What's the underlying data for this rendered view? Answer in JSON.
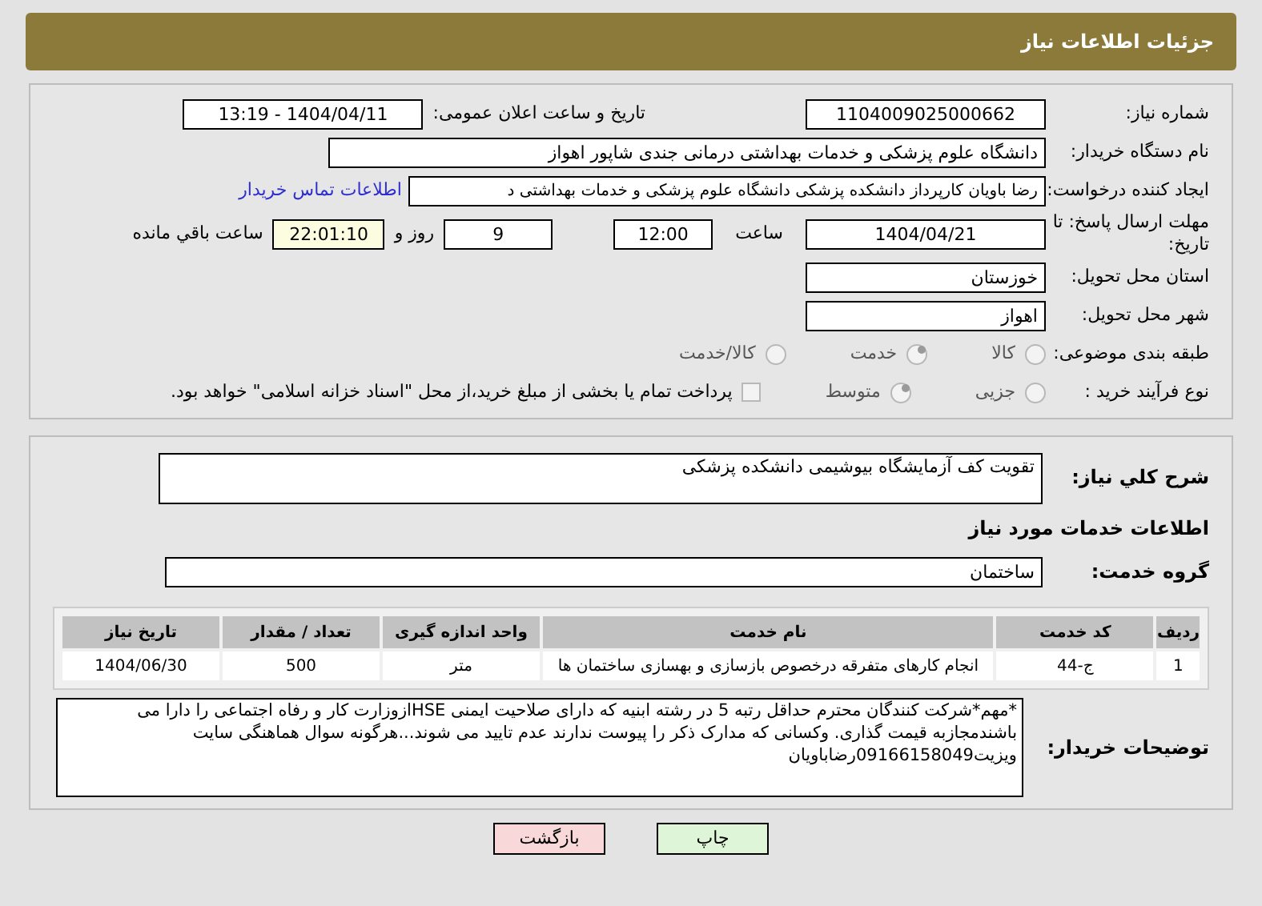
{
  "header": {
    "title": "جزئیات اطلاعات نیاز"
  },
  "details": {
    "need_number": {
      "label": "شماره نیاز:",
      "value": "1104009025000662"
    },
    "announce": {
      "label": "تاریخ و ساعت اعلان عمومی:",
      "value": "1404/04/11 - 13:19"
    },
    "buyer": {
      "label": "نام دستگاه خریدار:",
      "value": "دانشگاه علوم پزشکی و خدمات بهداشتی درمانی جندی شاپور اهواز"
    },
    "creator": {
      "label": "ایجاد کننده درخواست:",
      "value": "رضا باویان کارپرداز دانشکده پزشکی دانشگاه علوم پزشکی و خدمات بهداشتی د",
      "link": "اطلاعات تماس خریدار"
    },
    "deadline": {
      "label": "مهلت ارسال پاسخ: تا تاریخ:",
      "date": "1404/04/21",
      "time_label": "ساعت",
      "time": "12:00",
      "days": "9",
      "days_label": "روز و",
      "remaining": "22:01:10",
      "remaining_label": "ساعت باقي مانده"
    },
    "province": {
      "label": "استان محل تحویل:",
      "value": "خوزستان"
    },
    "city": {
      "label": "شهر محل تحویل:",
      "value": "اهواز"
    },
    "category": {
      "label": "طبقه بندی موضوعی:",
      "options": [
        {
          "label": "کالا",
          "selected": false
        },
        {
          "label": "خدمت",
          "selected": true
        },
        {
          "label": "کالا/خدمت",
          "selected": false
        }
      ]
    },
    "process": {
      "label": "نوع فرآیند خرید :",
      "options": [
        {
          "label": "جزیی",
          "selected": false
        },
        {
          "label": "متوسط",
          "selected": true
        }
      ],
      "treasury": {
        "label": "پرداخت تمام یا بخشی از مبلغ خرید،از محل \"اسناد خزانه اسلامی\" خواهد بود.",
        "checked": false
      }
    }
  },
  "services": {
    "summary": {
      "label": "شرح کلي نیاز:",
      "value": "تقویت کف آزمایشگاه بیوشیمی دانشکده پزشکی"
    },
    "heading": "اطلاعات خدمات مورد نیاز",
    "group": {
      "label": "گروه خدمت:",
      "value": "ساختمان"
    },
    "table": {
      "columns": [
        "ردیف",
        "کد خدمت",
        "نام خدمت",
        "واحد اندازه گیری",
        "تعداد / مقدار",
        "تاریخ نیاز"
      ],
      "rows": [
        [
          "1",
          "ج-44",
          "انجام کارهای متفرقه درخصوص بازسازی و بهسازی ساختمان ها",
          "متر",
          "500",
          "1404/06/30"
        ]
      ]
    },
    "notes": {
      "label": "توضیحات خریدار:",
      "value": "*مهم*شرکت کنندگان محترم حداقل  رتبه 5 در رشته ابنیه که دارای صلاحیت ایمنی HSEازوزارت کار و رفاه اجتماعی را دارا می باشندمجازبه قیمت گذاری. وکسانی که مدارک ذکر را پیوست ندارند عدم تایید می شوند...هرگونه سوال هماهنگی سایت ویزیت09166158049رضاباویان"
    }
  },
  "buttons": [
    {
      "label": "چاپ",
      "kind": "print"
    },
    {
      "label": "بازگشت",
      "kind": "back"
    }
  ]
}
